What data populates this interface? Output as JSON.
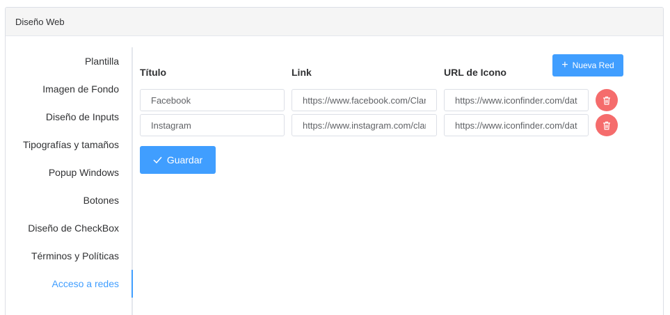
{
  "panel": {
    "title": "Diseño Web"
  },
  "sidebar": {
    "items": [
      {
        "label": "Plantilla"
      },
      {
        "label": "Imagen de Fondo"
      },
      {
        "label": "Diseño de Inputs"
      },
      {
        "label": "Tipografías y tamaños"
      },
      {
        "label": "Popup Windows"
      },
      {
        "label": "Botones"
      },
      {
        "label": "Diseño de CheckBox"
      },
      {
        "label": "Términos y Políticas"
      },
      {
        "label": "Acceso a redes"
      }
    ],
    "active": "Acceso a redes"
  },
  "form": {
    "columns": {
      "title": "Título",
      "link": "Link",
      "icon_url": "URL de Icono"
    },
    "add_button": "Nueva Red",
    "save_button": "Guardar",
    "rows": [
      {
        "title": "Facebook",
        "link": "https://www.facebook.com/Claro",
        "icon_url": "https://www.iconfinder.com/data/icons"
      },
      {
        "title": "Instagram",
        "link": "https://www.instagram.com/claro",
        "icon_url": "https://www.iconfinder.com/data/icons"
      }
    ]
  },
  "colors": {
    "accent": "#409eff",
    "danger": "#f56c6c"
  }
}
